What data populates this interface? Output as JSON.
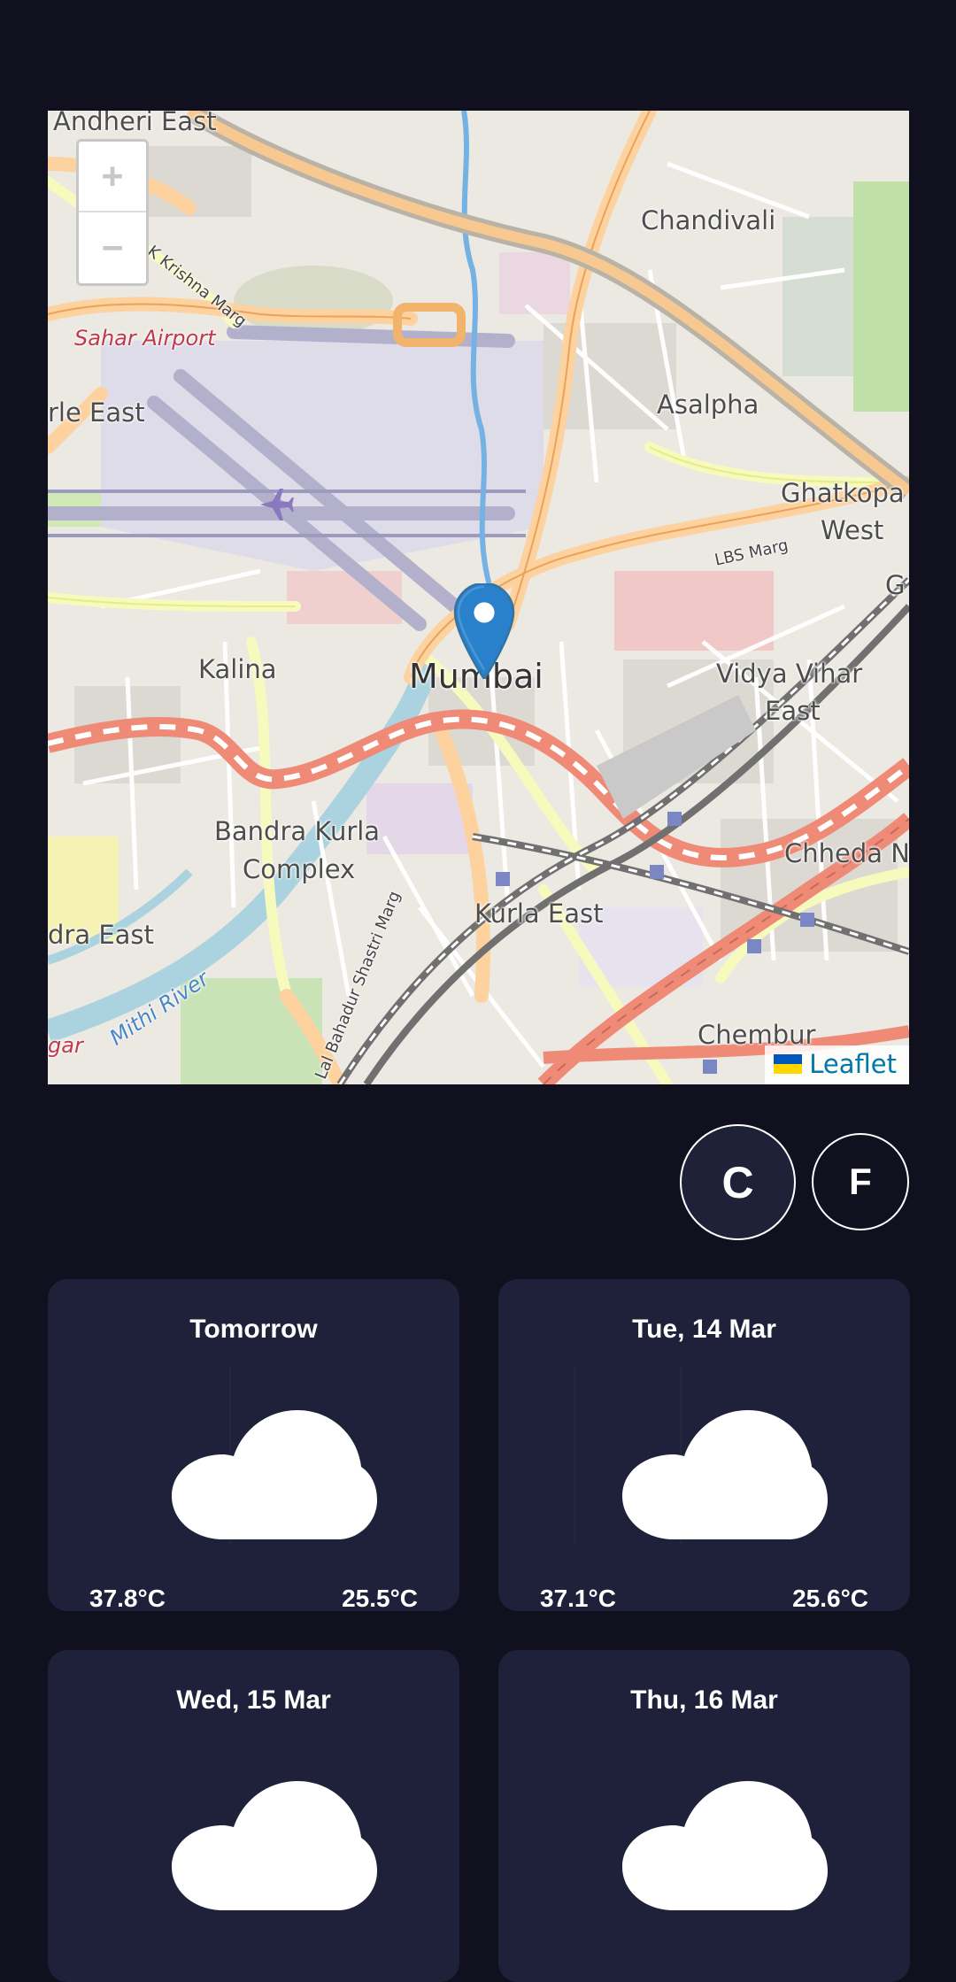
{
  "map": {
    "labels": {
      "andheri_east": "Andheri East",
      "chandivali": "Chandivali",
      "k_krishna_marg": "K Krishna Marg",
      "sahar_airport": "Sahar Airport",
      "vile_parle_east": "rle East",
      "asalpha": "Asalpha",
      "ghatkopar_west_1": "Ghatkopa",
      "ghatkopar_west_2": "West",
      "lbs_marg": "LBS Marg",
      "kalina": "Kalina",
      "mumbai": "Mumbai",
      "vidya_vihar_1": "Vidya Vihar",
      "vidya_vihar_2": "East",
      "bkc_1": "Bandra Kurla",
      "bkc_2": "Complex",
      "chheda_nagar": "Chheda N",
      "kurla_east": "Kurla East",
      "bandra_east": "dra East",
      "mithi_river": "Mithi River",
      "lbs_shastri_marg": "Lal Bahadur Shastri Marg",
      "chembur": "Chembur",
      "gar": "gar",
      "g_edge": "G"
    },
    "zoom_in_label": "+",
    "zoom_out_label": "−",
    "attribution": "Leaflet",
    "marker_icon": "map-pin-icon"
  },
  "units": {
    "celsius": "C",
    "fahrenheit": "F",
    "selected": "C"
  },
  "forecast": [
    {
      "day": "Tomorrow",
      "max": "37.8°C",
      "min": "25.5°C",
      "icon": "cloud-icon"
    },
    {
      "day": "Tue, 14 Mar",
      "max": "37.1°C",
      "min": "25.6°C",
      "icon": "cloud-icon"
    },
    {
      "day": "Wed, 15 Mar",
      "max": "",
      "min": "",
      "icon": "cloud-icon"
    },
    {
      "day": "Thu, 16 Mar",
      "max": "",
      "min": "",
      "icon": "cloud-icon"
    }
  ],
  "colors": {
    "background": "#10101e",
    "card": "#1e2139",
    "marker": "#2a81cb",
    "attribution_link": "#0078a8"
  }
}
